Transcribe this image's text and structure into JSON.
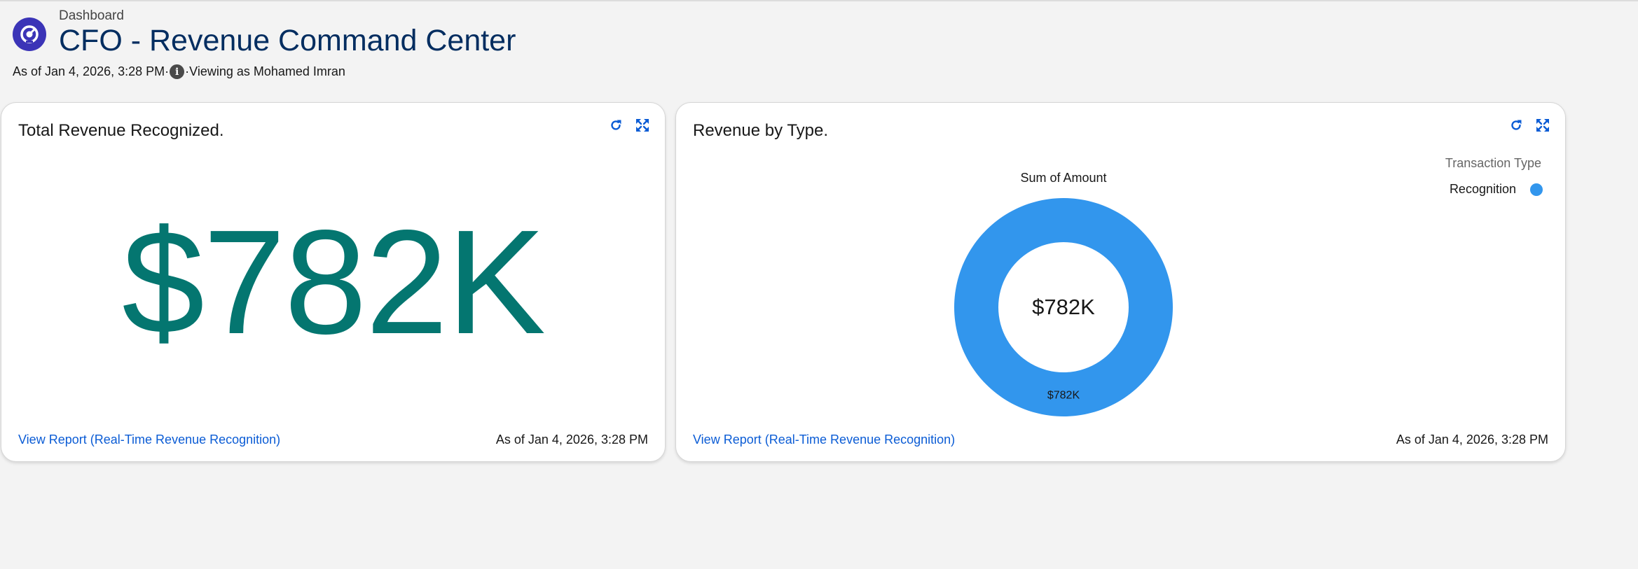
{
  "header": {
    "eyebrow": "Dashboard",
    "title": "CFO - Revenue Command Center",
    "as_of": "As of Jan 4, 2026, 3:28 PM·",
    "info_glyph": "i",
    "viewing_as": "·Viewing as Mohamed Imran",
    "icon": "dashboard-gauge-icon",
    "icon_color": "#3b34b7"
  },
  "cards": [
    {
      "title": "Total Revenue Recognized.",
      "metric": "$782K",
      "metric_color": "#047670",
      "link": "View Report (Real-Time Revenue Recognition)",
      "as_of": "As of Jan 4, 2026, 3:28 PM",
      "actions": [
        "refresh-icon",
        "expand-icon"
      ]
    },
    {
      "title": "Revenue by Type.",
      "link": "View Report (Real-Time Revenue Recognition)",
      "as_of": "As of Jan 4, 2026, 3:28 PM",
      "actions": [
        "refresh-icon",
        "expand-icon"
      ]
    }
  ],
  "chart_data": {
    "type": "pie",
    "style": "donut",
    "title": "Sum of Amount",
    "center_label": "$782K",
    "legend_title": "Transaction Type",
    "legend_position": "top-right",
    "categories": [
      "Recognition"
    ],
    "values": [
      782000
    ],
    "value_labels": [
      "$782K"
    ],
    "colors": [
      "#3296ed"
    ]
  }
}
